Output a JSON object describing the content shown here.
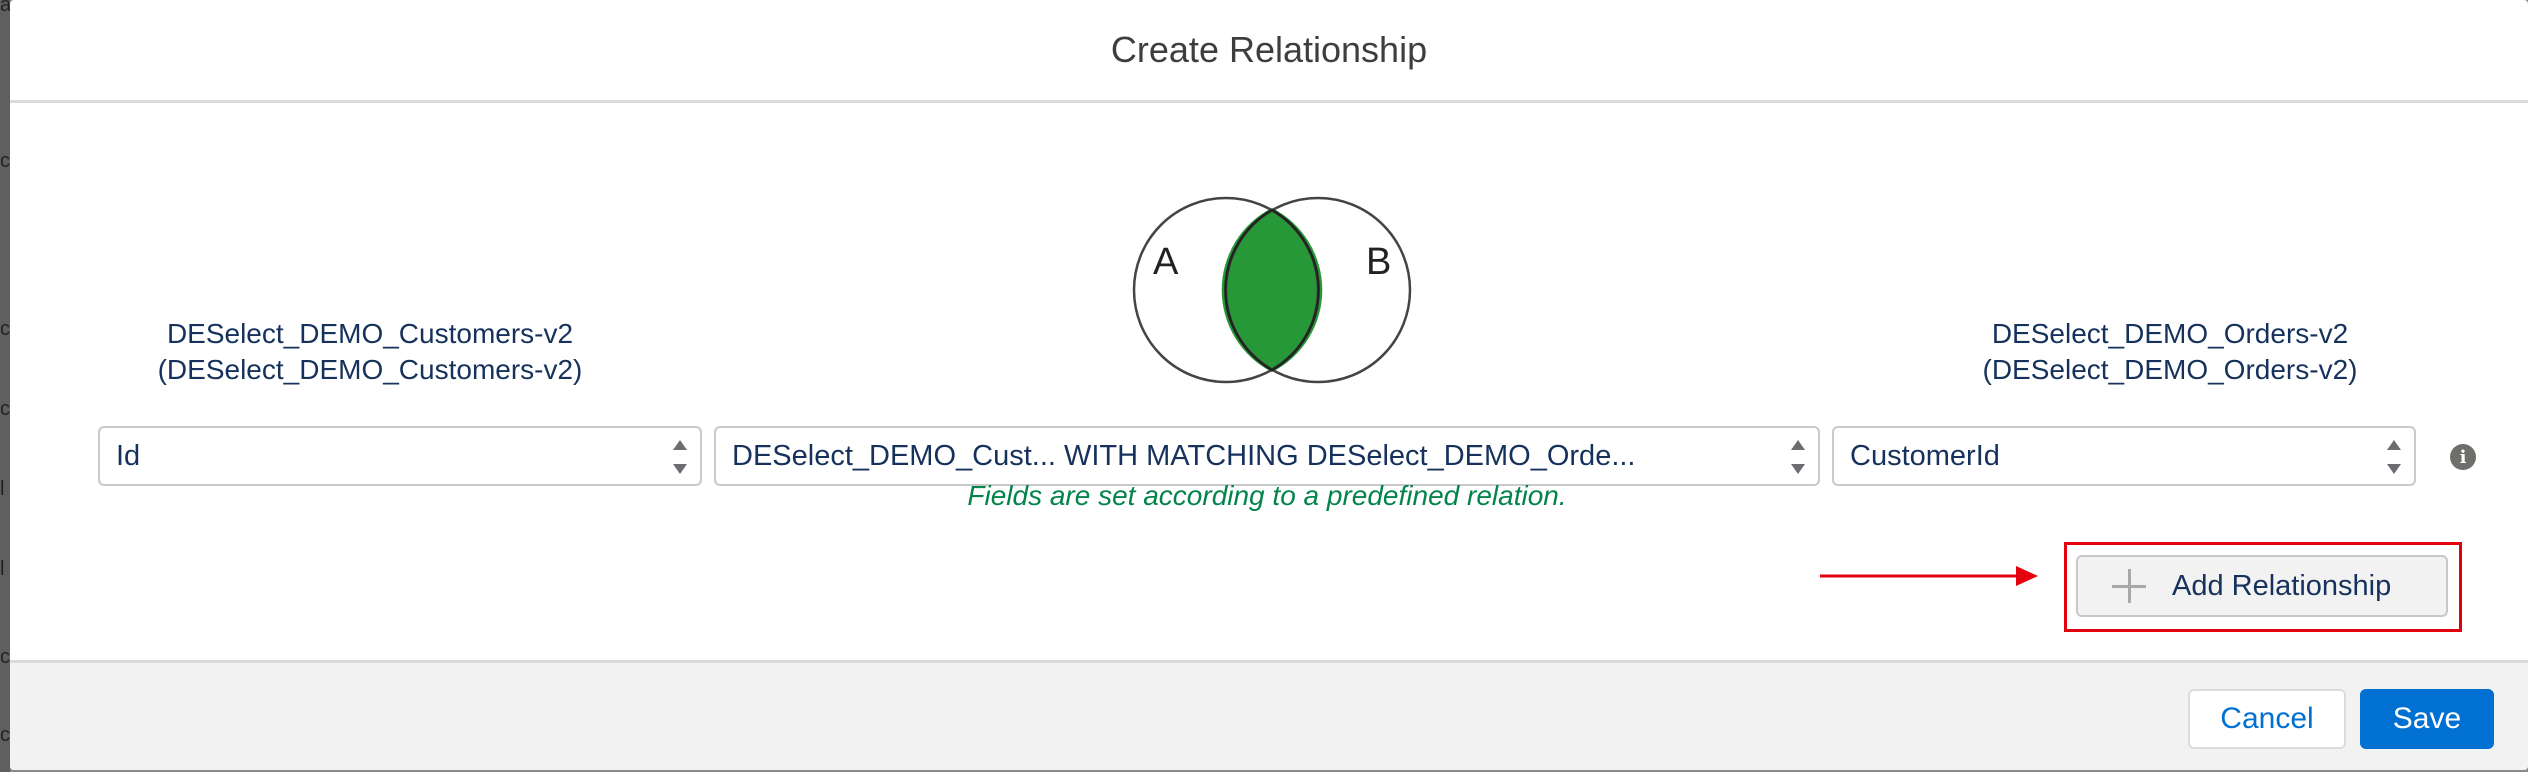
{
  "modal": {
    "title": "Create Relationship"
  },
  "venn": {
    "label_a": "A",
    "label_b": "B",
    "intersection_color": "#279837"
  },
  "left_source": {
    "line1": "DESelect_DEMO_Customers-v2",
    "line2": "(DESelect_DEMO_Customers-v2)",
    "field": "Id"
  },
  "relation": {
    "value": "DESelect_DEMO_Cust... WITH MATCHING DESelect_DEMO_Orde...",
    "note": "Fields are set according to a predefined relation."
  },
  "right_source": {
    "line1": "DESelect_DEMO_Orders-v2",
    "line2": "(DESelect_DEMO_Orders-v2)",
    "field": "CustomerId"
  },
  "info_icon": "i",
  "add_relationship": {
    "label": "Add Relationship",
    "icon": "plus-icon"
  },
  "annotation": {
    "color": "#e3000f"
  },
  "footer": {
    "cancel_label": "Cancel",
    "save_label": "Save"
  },
  "background_letters": [
    "a",
    "c",
    "c",
    "c",
    "l",
    "l",
    "c",
    "c"
  ]
}
